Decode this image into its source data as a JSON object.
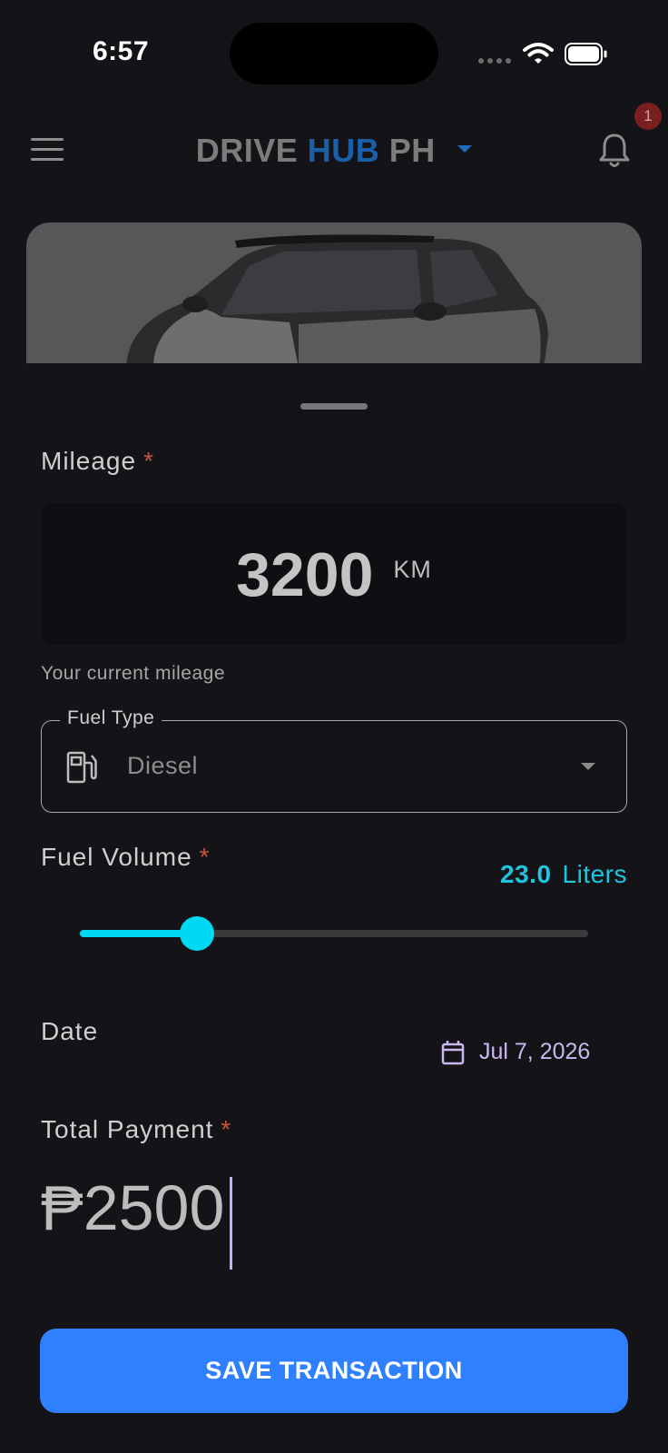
{
  "status_bar": {
    "time": "6:57"
  },
  "header": {
    "brand_part1": "DRIVE",
    "brand_part2": "HUB",
    "brand_part3": "PH",
    "notification_count": "1",
    "icons": {
      "menu": "menu-icon",
      "bell": "bell-icon",
      "dropdown": "chevron-down-icon"
    }
  },
  "form": {
    "mileage": {
      "label": "Mileage",
      "required_mark": "*",
      "value": "3200",
      "unit": "KM",
      "helper": "Your current mileage"
    },
    "fuel_type": {
      "label": "Fuel Type",
      "value": "Diesel",
      "icon": "fuel-pump-icon"
    },
    "fuel_volume": {
      "label": "Fuel Volume",
      "required_mark": "*",
      "value": "23.0",
      "unit": "Liters",
      "slider_fraction": 0.23
    },
    "date": {
      "label": "Date",
      "value": "Jul 7, 2026",
      "icon": "calendar-icon"
    },
    "total_payment": {
      "label": "Total Payment",
      "required_mark": "*",
      "value": "₱2500"
    }
  },
  "actions": {
    "save_label": "SAVE TRANSACTION"
  },
  "colors": {
    "background": "#141317",
    "accent_cyan": "#00d9f2",
    "primary_button": "#2f80ff",
    "brand_blue": "#1b5fa8",
    "required": "#c9533d",
    "date_text": "#c9b8ee"
  }
}
